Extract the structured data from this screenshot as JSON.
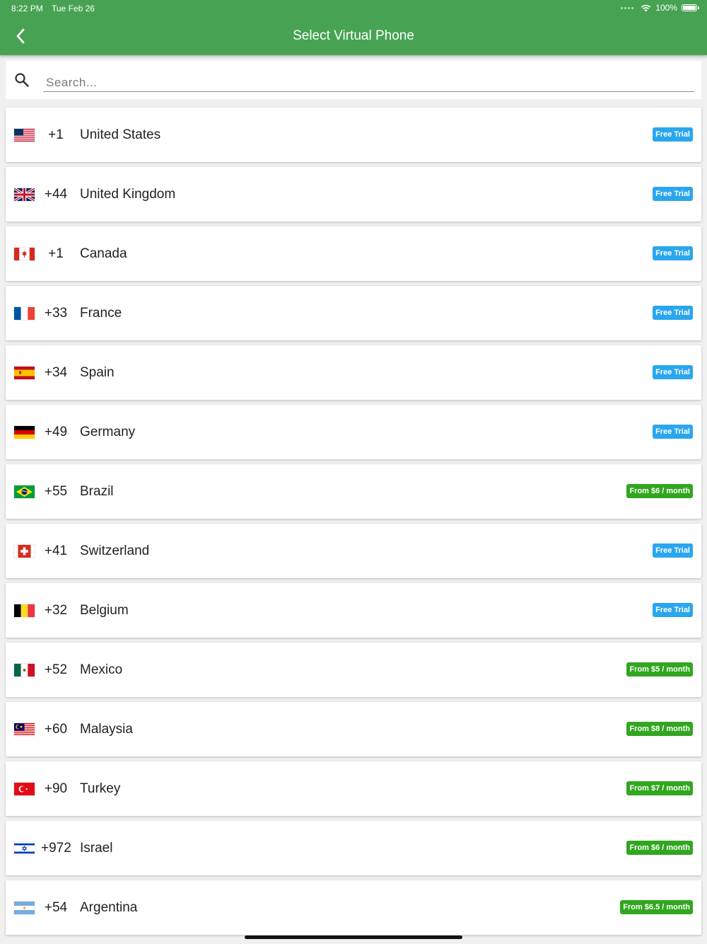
{
  "status_bar": {
    "time": "8:22 PM",
    "date": "Tue Feb 26",
    "battery": "100%"
  },
  "header": {
    "title": "Select Virtual Phone",
    "back_icon": "chevron-left-icon"
  },
  "search": {
    "placeholder": "Search...",
    "value": "",
    "icon": "search-icon"
  },
  "colors": {
    "header_green": "#47a353",
    "free_trial_badge": "#2aa6ee",
    "price_badge": "#31a61f"
  },
  "countries": [
    {
      "flag": "us",
      "code": "+1",
      "name": "United States",
      "badge": "Free Trial",
      "badge_type": "trial"
    },
    {
      "flag": "gb",
      "code": "+44",
      "name": "United Kingdom",
      "badge": "Free Trial",
      "badge_type": "trial"
    },
    {
      "flag": "ca",
      "code": "+1",
      "name": "Canada",
      "badge": "Free Trial",
      "badge_type": "trial"
    },
    {
      "flag": "fr",
      "code": "+33",
      "name": "France",
      "badge": "Free Trial",
      "badge_type": "trial"
    },
    {
      "flag": "es",
      "code": "+34",
      "name": "Spain",
      "badge": "Free Trial",
      "badge_type": "trial"
    },
    {
      "flag": "de",
      "code": "+49",
      "name": "Germany",
      "badge": "Free Trial",
      "badge_type": "trial"
    },
    {
      "flag": "br",
      "code": "+55",
      "name": "Brazil",
      "badge": "From $6 / month",
      "badge_type": "paid"
    },
    {
      "flag": "ch",
      "code": "+41",
      "name": "Switzerland",
      "badge": "Free Trial",
      "badge_type": "trial"
    },
    {
      "flag": "be",
      "code": "+32",
      "name": "Belgium",
      "badge": "Free Trial",
      "badge_type": "trial"
    },
    {
      "flag": "mx",
      "code": "+52",
      "name": "Mexico",
      "badge": "From $5 / month",
      "badge_type": "paid"
    },
    {
      "flag": "my",
      "code": "+60",
      "name": "Malaysia",
      "badge": "From $8 / month",
      "badge_type": "paid"
    },
    {
      "flag": "tr",
      "code": "+90",
      "name": "Turkey",
      "badge": "From $7 / month",
      "badge_type": "paid"
    },
    {
      "flag": "il",
      "code": "+972",
      "name": "Israel",
      "badge": "From $6 / month",
      "badge_type": "paid"
    },
    {
      "flag": "ar",
      "code": "+54",
      "name": "Argentina",
      "badge": "From $6.5 / month",
      "badge_type": "paid"
    }
  ]
}
